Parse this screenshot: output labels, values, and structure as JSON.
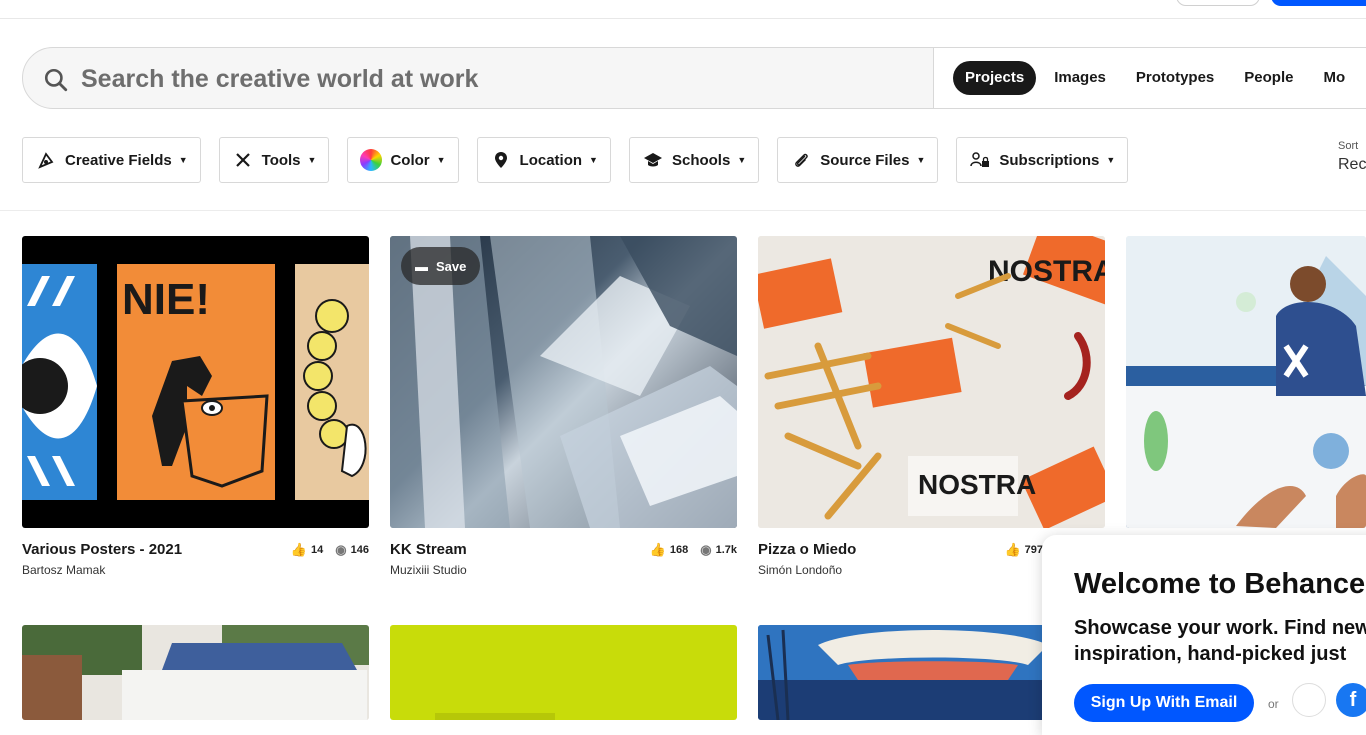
{
  "search": {
    "placeholder": "Search the creative world at work",
    "tabs": [
      {
        "label": "Projects",
        "active": true
      },
      {
        "label": "Images"
      },
      {
        "label": "Prototypes"
      },
      {
        "label": "People"
      },
      {
        "label": "Mo"
      }
    ]
  },
  "filters": [
    {
      "label": "Creative Fields",
      "icon": "pen-tool-icon"
    },
    {
      "label": "Tools",
      "icon": "tools-icon"
    },
    {
      "label": "Color",
      "icon": "color-wheel-icon"
    },
    {
      "label": "Location",
      "icon": "location-pin-icon"
    },
    {
      "label": "Schools",
      "icon": "graduation-cap-icon"
    },
    {
      "label": "Source Files",
      "icon": "paperclip-icon"
    },
    {
      "label": "Subscriptions",
      "icon": "subscription-lock-icon"
    }
  ],
  "sort": {
    "label": "Sort",
    "value": "Rec"
  },
  "projects": [
    {
      "title": "Various Posters - 2021",
      "owner": "Bartosz Mamak",
      "likes": "14",
      "views": "146"
    },
    {
      "title": "KK Stream",
      "owner": "Muzixiii Studio",
      "likes": "168",
      "views": "1.7k",
      "save": "Save"
    },
    {
      "title": "Pizza o Miedo",
      "owner": "Simón Londoño",
      "likes": "797"
    }
  ],
  "modal": {
    "title": "Welcome to Behance",
    "text": "Showcase your work. Find new inspiration, hand-picked just",
    "signup": "Sign Up With Email",
    "or": "or"
  },
  "colors": {
    "brand": "#0057ff",
    "facebook": "#1877f2"
  }
}
